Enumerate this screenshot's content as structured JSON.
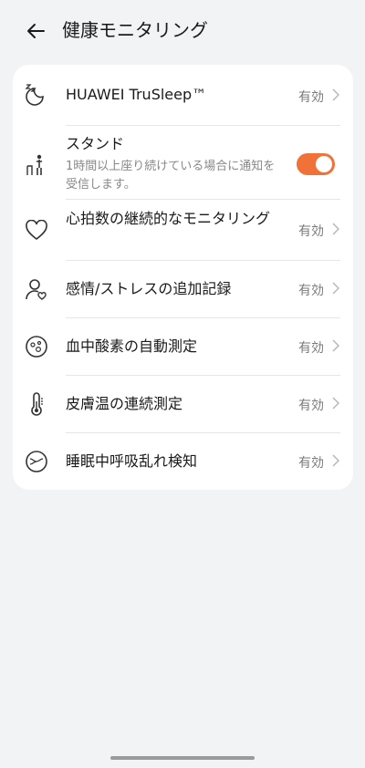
{
  "header": {
    "title": "健康モニタリング",
    "back_icon": "arrow-left-icon"
  },
  "items": [
    {
      "label": "HUAWEI TruSleep™",
      "status": "有効",
      "icon": "sleep-moon-icon"
    },
    {
      "label": "スタンド",
      "subtitle": "1時間以上座り続けている場合に通知を受信します。",
      "toggle": "on",
      "icon": "stand-person-icon"
    },
    {
      "label": "心拍数の継続的なモニタリング",
      "status": "有効",
      "icon": "heart-icon"
    },
    {
      "label": "感情/ストレスの追加記録",
      "status": "有効",
      "icon": "person-heart-icon"
    },
    {
      "label": "血中酸素の自動測定",
      "status": "有効",
      "icon": "blood-oxygen-icon"
    },
    {
      "label": "皮膚温の連続測定",
      "status": "有効",
      "icon": "thermometer-icon"
    },
    {
      "label": "睡眠中呼吸乱れ検知",
      "status": "有効",
      "icon": "breathing-icon"
    }
  ],
  "colors": {
    "accent": "#f07239",
    "background": "#f1f3f5"
  }
}
